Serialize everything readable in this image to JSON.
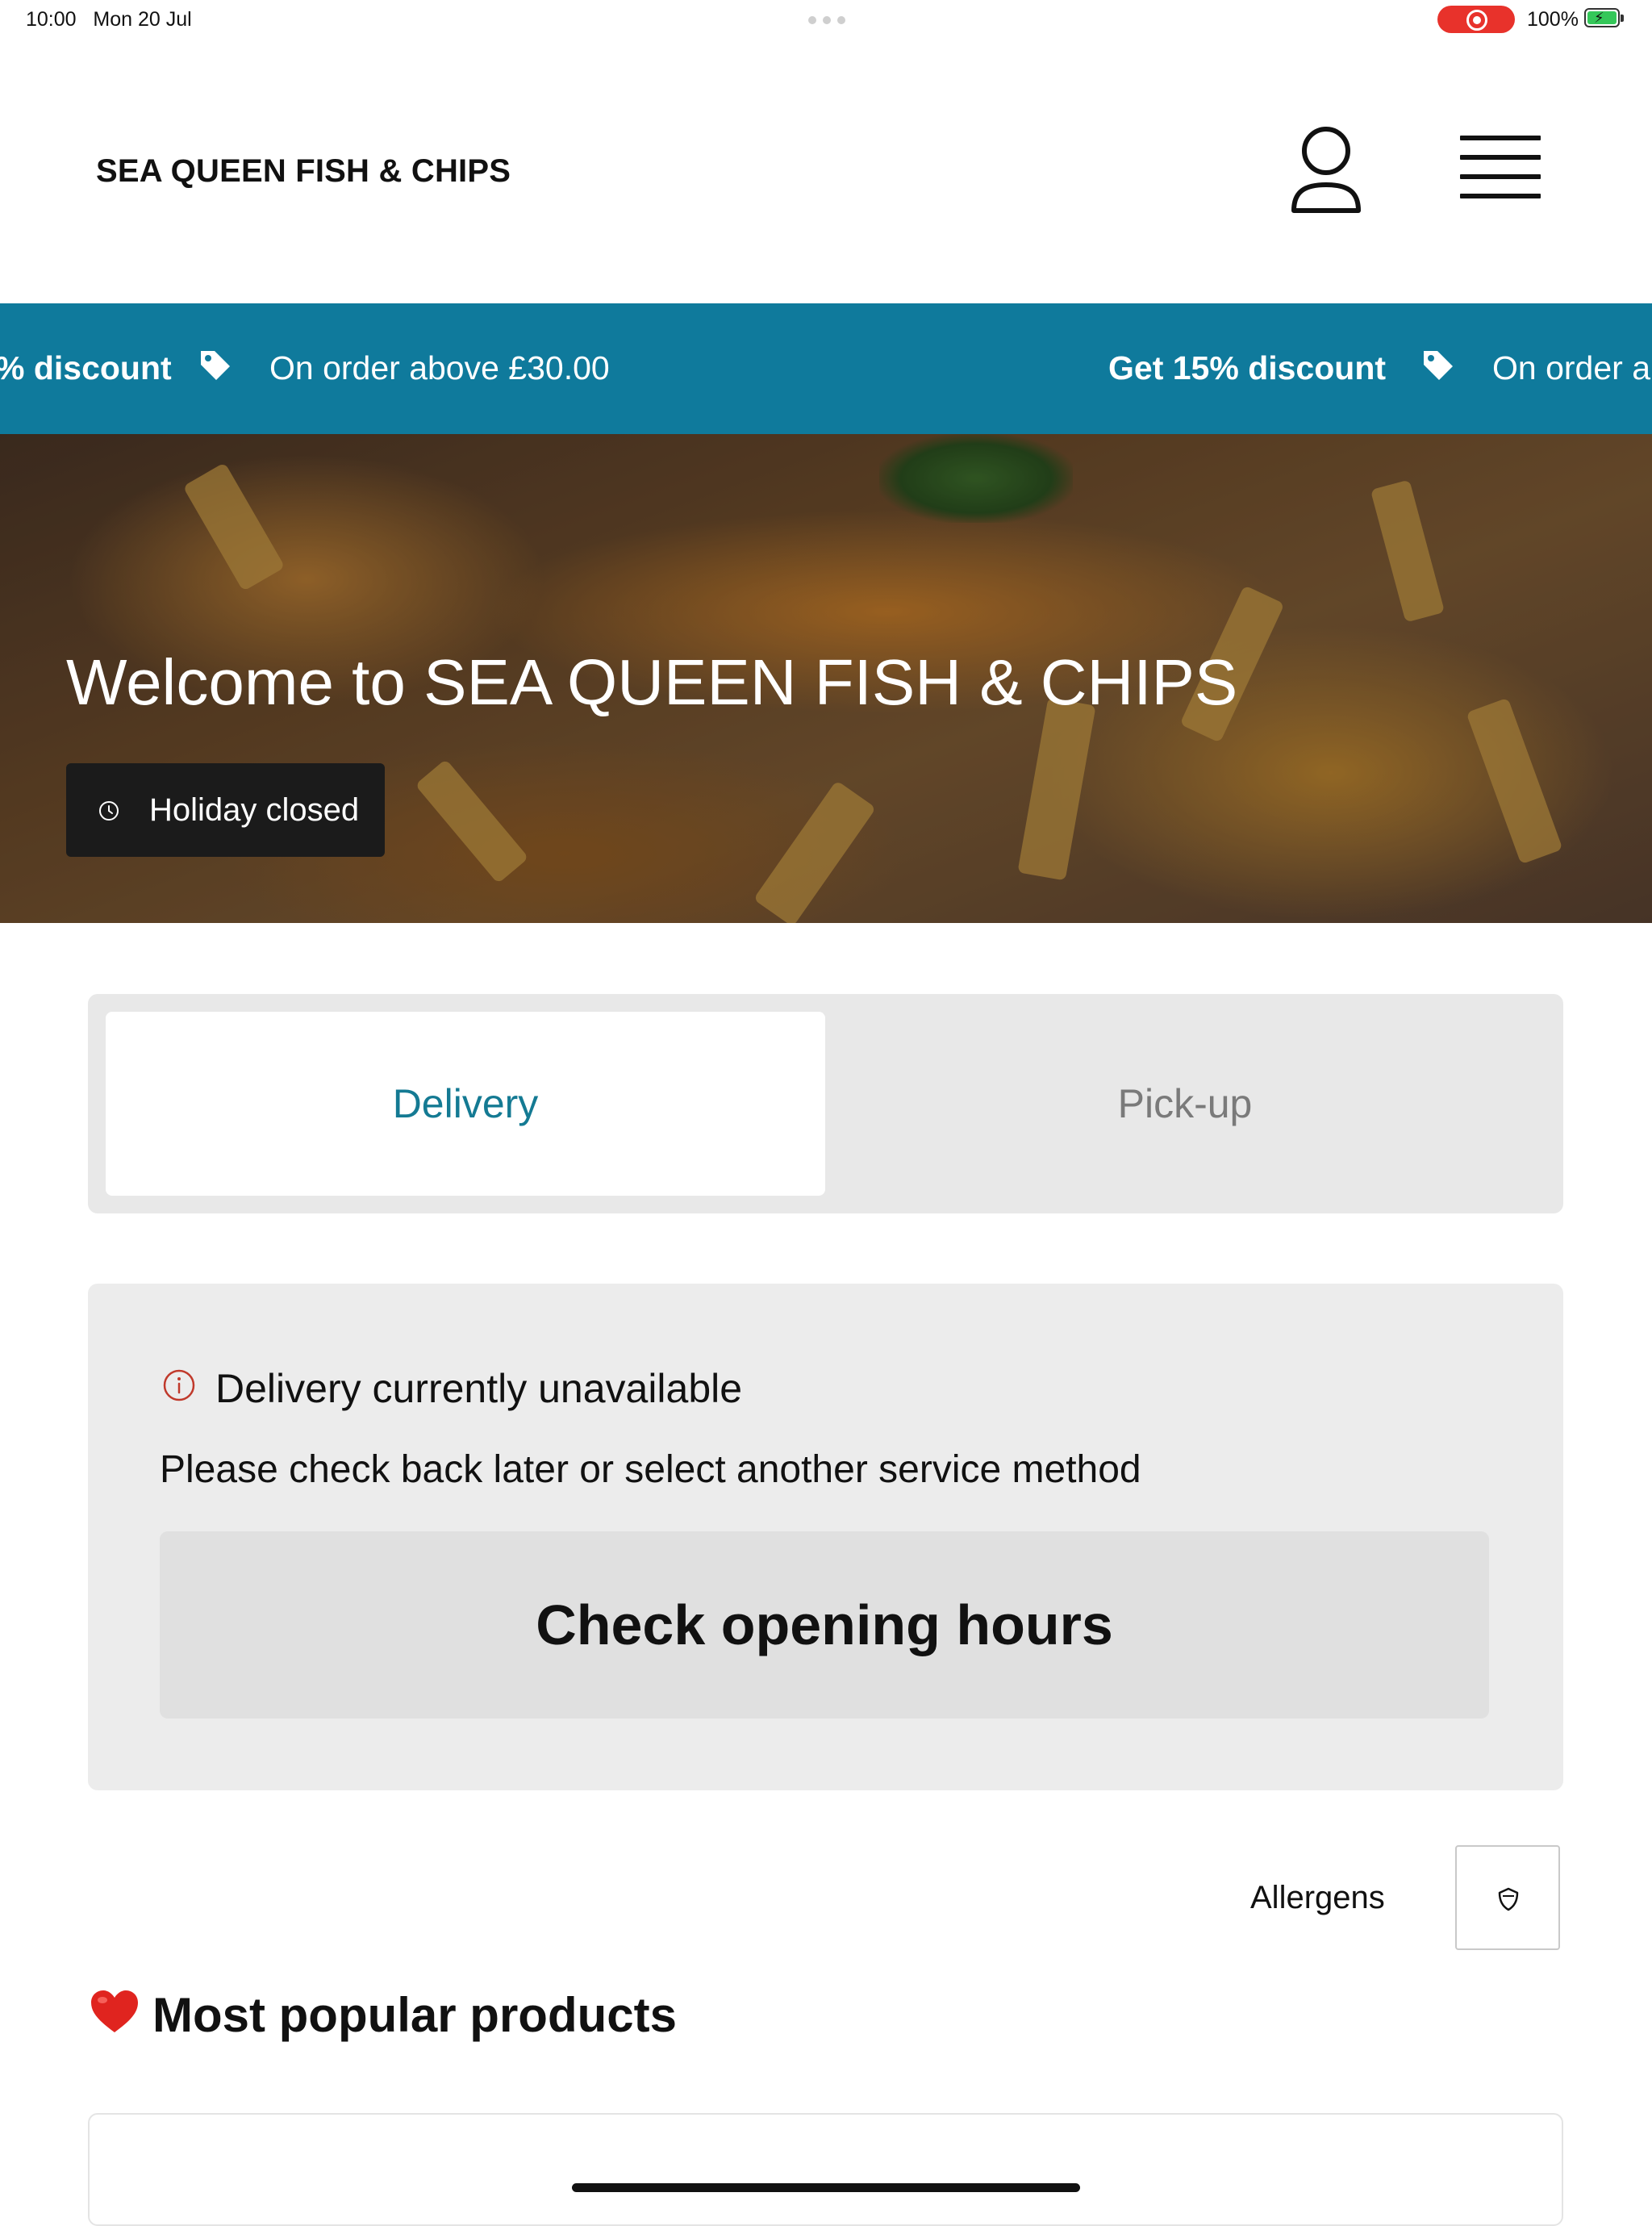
{
  "status_bar": {
    "time": "10:00",
    "date": "Mon 20 Jul",
    "battery": "100%",
    "recording_color": "#e8322b"
  },
  "header": {
    "brand": "SEA QUEEN FISH & CHIPS",
    "account_icon": "user-icon",
    "menu_icon": "hamburger-menu-icon"
  },
  "promo": {
    "background": "#0f7a9c",
    "items": [
      {
        "title": "% discount",
        "detail": "On order above £30.00"
      },
      {
        "title": "Get 15% discount",
        "detail": "On order ab"
      }
    ]
  },
  "hero": {
    "title": "Welcome to SEA QUEEN FISH & CHIPS",
    "status_label": "Holiday closed"
  },
  "service_tabs": {
    "active_color": "#147a93",
    "tabs": [
      {
        "label": "Delivery",
        "active": true
      },
      {
        "label": "Pick-up",
        "active": false
      }
    ]
  },
  "notice": {
    "title": "Delivery currently unavailable",
    "message": "Please check back later or select another service method",
    "button": "Check opening hours",
    "icon_color": "#c0392b"
  },
  "allergens": {
    "label": "Allergens"
  },
  "popular": {
    "title": "Most popular products"
  }
}
